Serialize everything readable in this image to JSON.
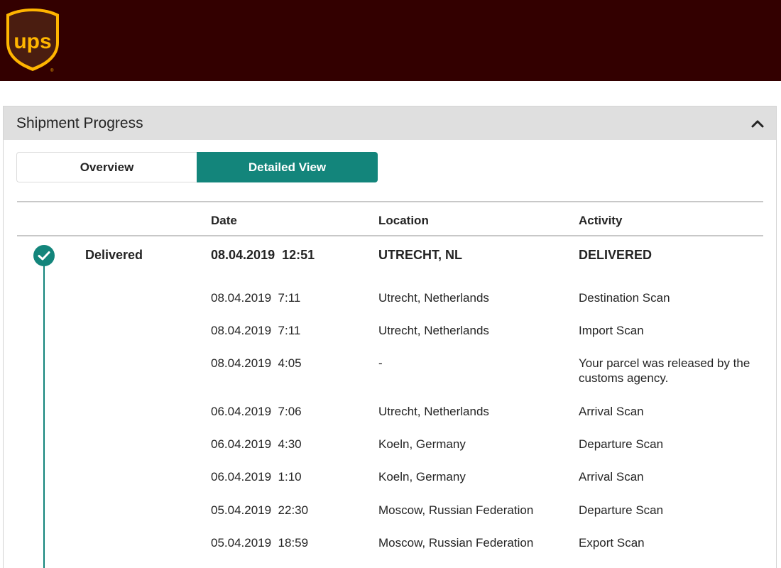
{
  "brand": {
    "logo_text": "ups",
    "primary_color": "#330000",
    "gold_color": "#ffb500",
    "accent_color": "#13857b"
  },
  "panel": {
    "title": "Shipment Progress",
    "collapse_icon": "chevron-up-icon"
  },
  "tabs": [
    {
      "label": "Overview",
      "active": false
    },
    {
      "label": "Detailed View",
      "active": true
    }
  ],
  "columns": {
    "date": "Date",
    "location": "Location",
    "activity": "Activity"
  },
  "status": {
    "label": "Delivered",
    "icon": "check-circle-icon"
  },
  "events": [
    {
      "date": "08.04.2019",
      "time": "12:51",
      "location": "UTRECHT, NL",
      "activity": "DELIVERED"
    },
    {
      "date": "08.04.2019",
      "time": "7:11",
      "location": "Utrecht, Netherlands",
      "activity": "Destination Scan"
    },
    {
      "date": "08.04.2019",
      "time": "7:11",
      "location": "Utrecht, Netherlands",
      "activity": "Import Scan"
    },
    {
      "date": "08.04.2019",
      "time": "4:05",
      "location": "-",
      "activity": "Your parcel was released by the customs agency."
    },
    {
      "date": "06.04.2019",
      "time": "7:06",
      "location": "Utrecht, Netherlands",
      "activity": "Arrival Scan"
    },
    {
      "date": "06.04.2019",
      "time": "4:30",
      "location": "Koeln, Germany",
      "activity": "Departure Scan"
    },
    {
      "date": "06.04.2019",
      "time": "1:10",
      "location": "Koeln, Germany",
      "activity": "Arrival Scan"
    },
    {
      "date": "05.04.2019",
      "time": "22:30",
      "location": "Moscow, Russian Federation",
      "activity": "Departure Scan"
    },
    {
      "date": "05.04.2019",
      "time": "18:59",
      "location": "Moscow, Russian Federation",
      "activity": "Export Scan"
    }
  ]
}
